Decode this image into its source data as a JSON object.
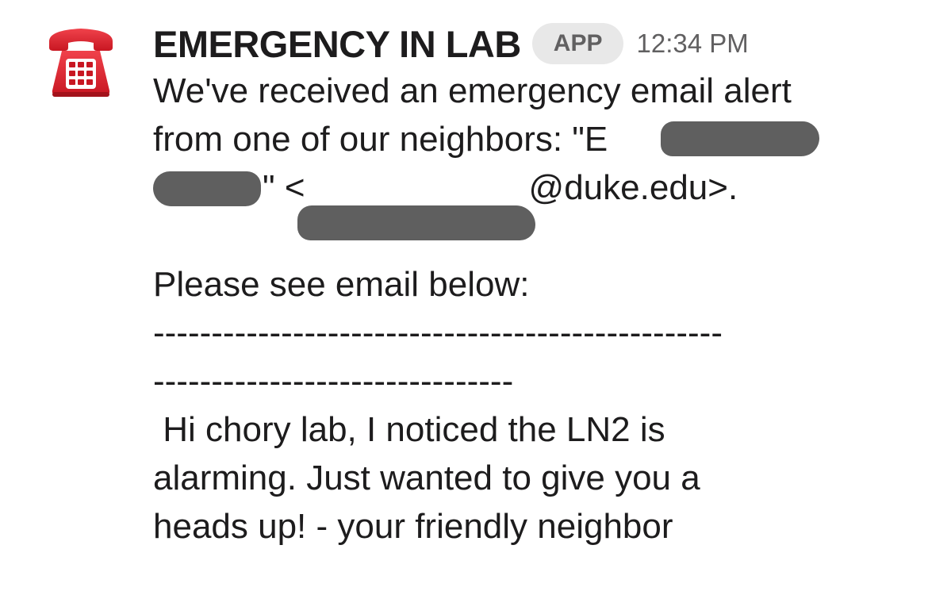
{
  "message": {
    "icon": "telephone-icon",
    "sender": "EMERGENCY IN LAB",
    "badge": "APP",
    "timestamp": "12:34 PM",
    "lines": {
      "l1": "We've received an emergency email alert",
      "l2": "from one of our neighbors: \"E",
      "l3_quote": "\" <",
      "l3_email": "@duke.edu>.",
      "l5": "Please see email below:",
      "l6": "-------------------------------------------------",
      "l7": "-------------------------------",
      "l8": " Hi chory lab, I noticed the LN2 is",
      "l9": "alarming. Just wanted to give you a",
      "l10": "heads up! - your friendly neighbor"
    }
  },
  "colors": {
    "text": "#1d1c1d",
    "muted": "#616061",
    "badge_bg": "#e8e8e8",
    "redaction": "#5f5f5f",
    "icon_red": "#d9232e"
  }
}
